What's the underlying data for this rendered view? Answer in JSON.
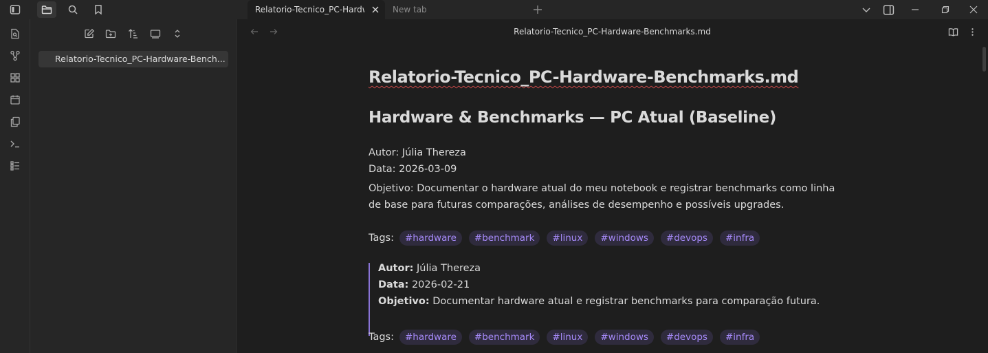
{
  "titlebar": {
    "tabs": [
      {
        "label": "Relatorio-Tecnico_PC-Hardware-Benchmarks.md",
        "active": true
      },
      {
        "label": "New tab",
        "active": false
      }
    ]
  },
  "sidebar": {
    "file_item": "Relatorio-Tecnico_PC-Hardware-Bench..."
  },
  "view": {
    "title": "Relatorio-Tecnico_PC-Hardware-Benchmarks.md"
  },
  "document": {
    "inline_title": "Relatorio-Tecnico_PC-Hardware-Benchmarks.md",
    "heading": "Hardware & Benchmarks — PC Atual (Baseline)",
    "author_line": "Autor: Júlia Thereza",
    "date_line": "Data: 2026-03-09",
    "objective_line": "Objetivo: Documentar o hardware atual do meu notebook e registrar benchmarks como linha de base para futuras comparações, análises de desempenho e possíveis upgrades.",
    "tags_label": "Tags:",
    "tags": [
      "#hardware",
      "#benchmark",
      "#linux",
      "#windows",
      "#devops",
      "#infra"
    ],
    "callout": {
      "author_key": "Autor:",
      "author_val": " Júlia Thereza",
      "date_key": "Data:",
      "date_val": " 2026-02-21",
      "objective_key": "Objetivo:",
      "objective_val": " Documentar hardware atual e registrar benchmarks para comparação futura."
    },
    "tags2_label": "Tags:",
    "tags2": [
      "#hardware",
      "#benchmark",
      "#linux",
      "#windows",
      "#devops",
      "#infra"
    ]
  },
  "colors": {
    "accent": "#a68af9",
    "tag_bg": "#2f2b3d",
    "background": "#1e1e1e",
    "chrome": "#262626"
  }
}
